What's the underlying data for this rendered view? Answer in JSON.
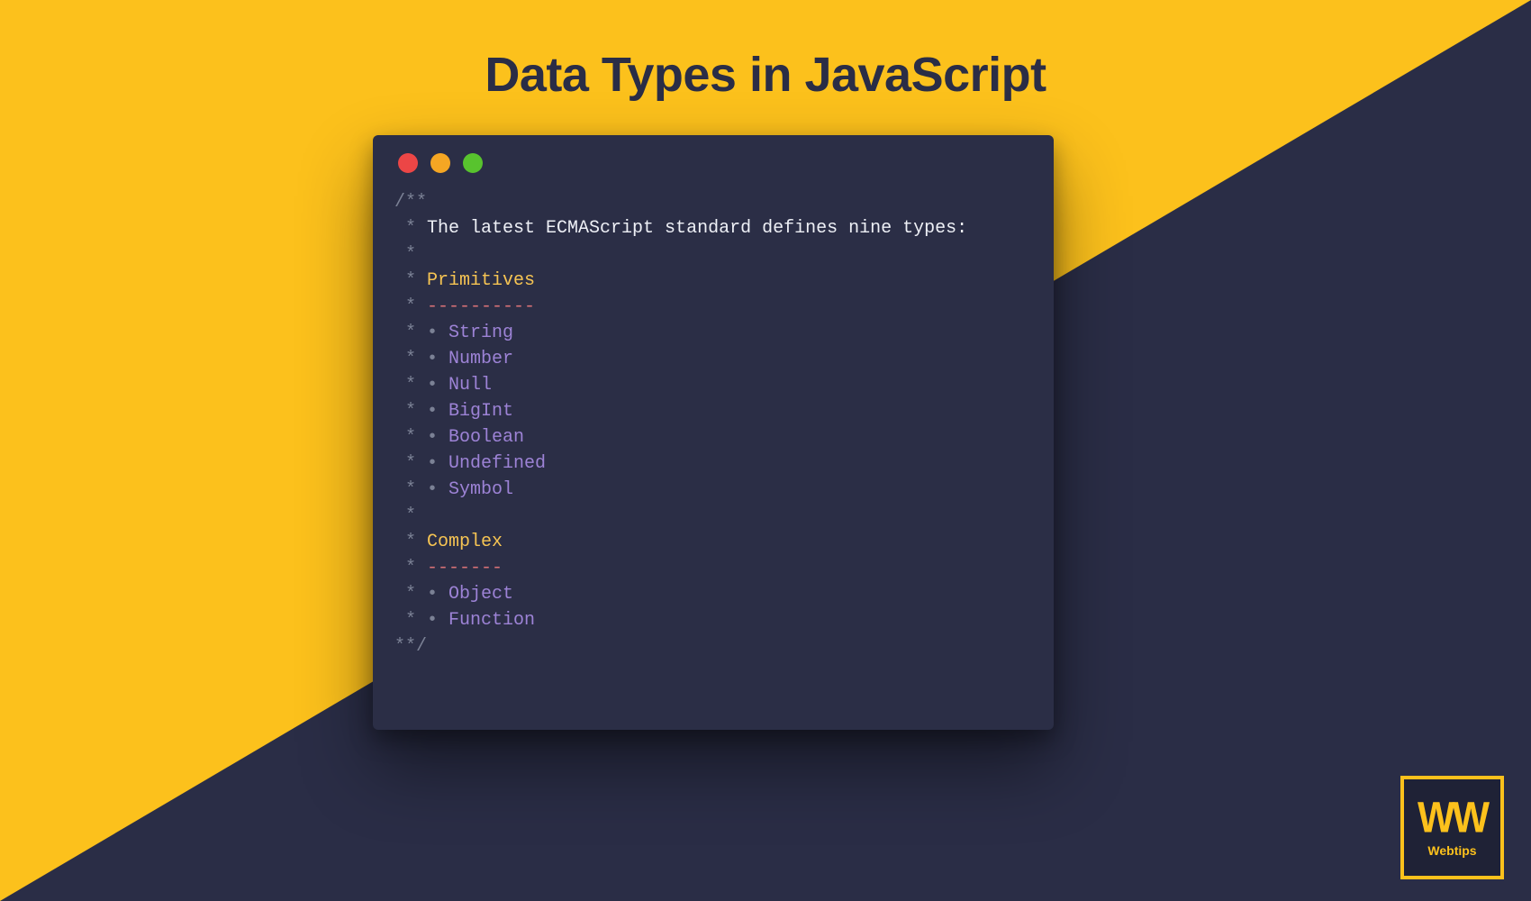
{
  "title": "Data Types in JavaScript",
  "code": {
    "open": "/**",
    "star": " *",
    "intro": "The latest ECMAScript standard defines nine types:",
    "section1": "Primitives",
    "div1": "----------",
    "primitives": [
      "String",
      "Number",
      "Null",
      "BigInt",
      "Boolean",
      "Undefined",
      "Symbol"
    ],
    "section2": "Complex",
    "div2": "-------",
    "complex": [
      "Object",
      "Function"
    ],
    "close": "**/",
    "bullet": "•"
  },
  "logo": {
    "mark": "WW",
    "name": "Webtips"
  }
}
